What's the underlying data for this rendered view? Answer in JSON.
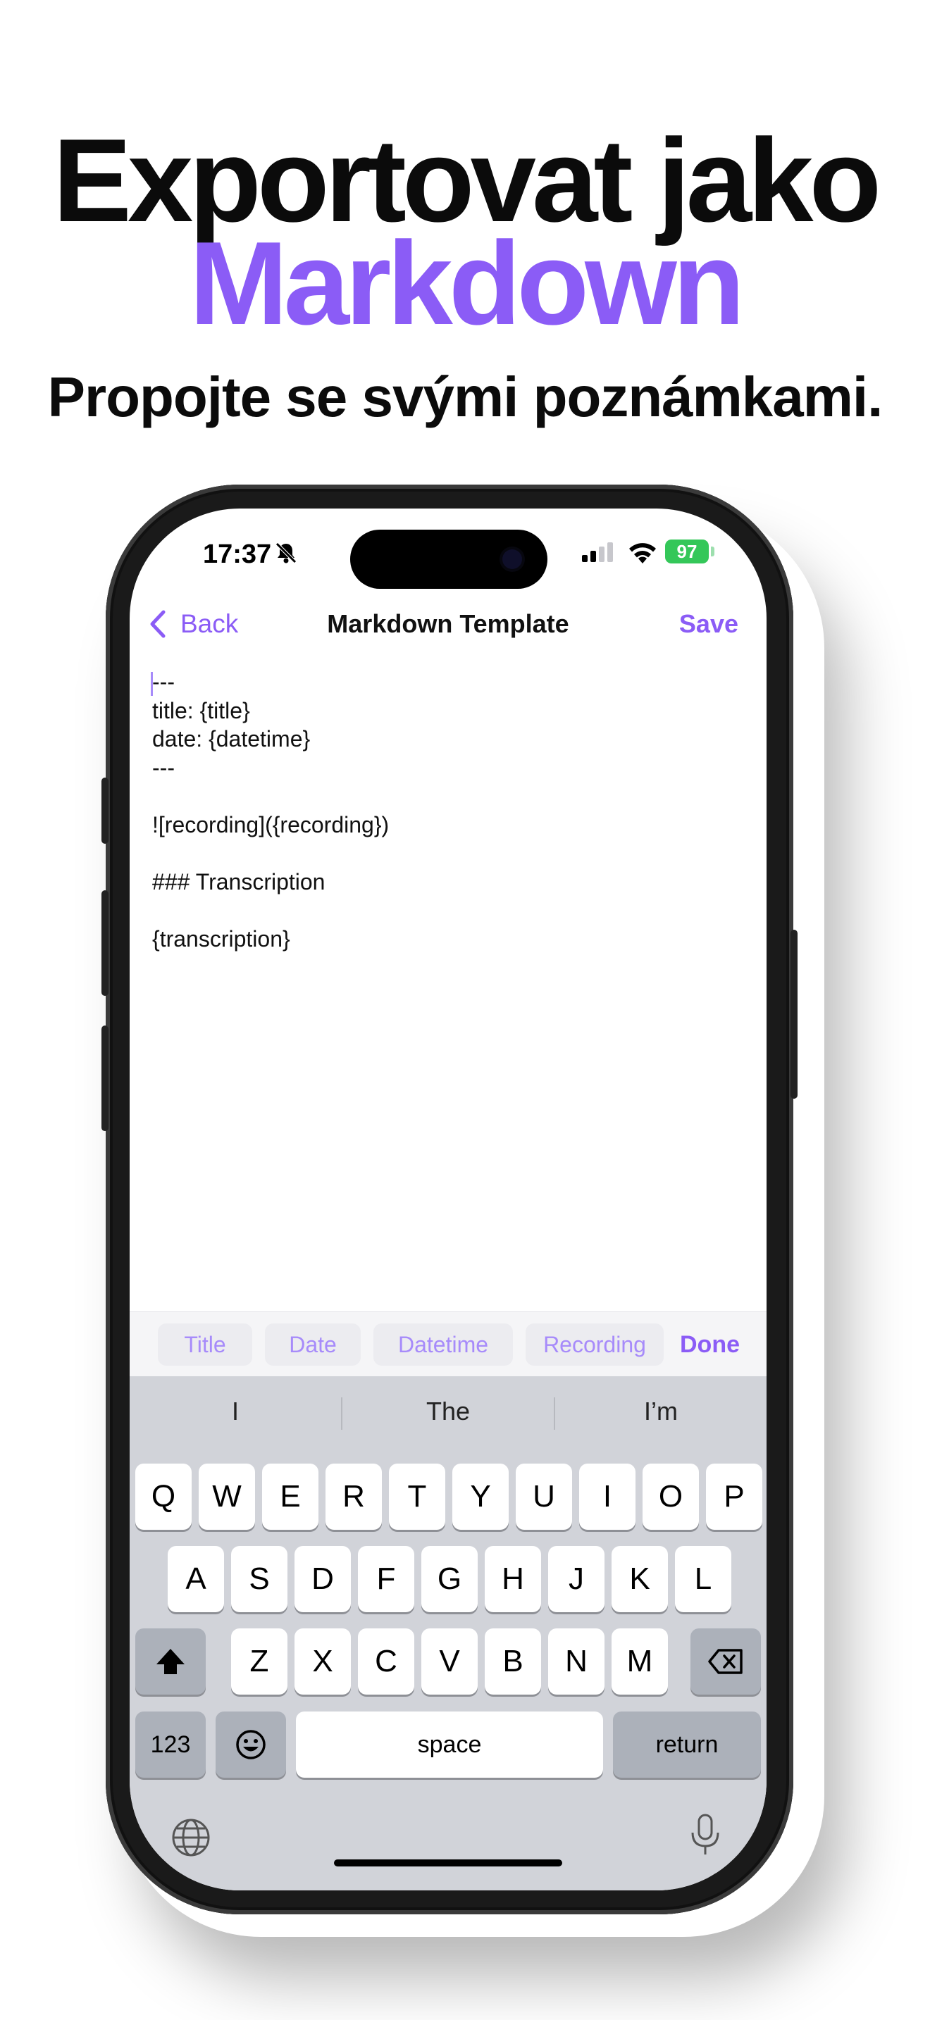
{
  "headline": {
    "line1": "Exportovat jako",
    "line2": "Markdown",
    "subtitle": "Propojte se svými poznámkami.",
    "accent_color": "#8b5cf6"
  },
  "status_bar": {
    "time": "17:37",
    "battery": "97",
    "icons": [
      "bell-slash-icon",
      "signal-icon",
      "wifi-icon",
      "battery-charging-icon"
    ]
  },
  "nav": {
    "back_label": "Back",
    "title": "Markdown Template",
    "save_label": "Save"
  },
  "editor": {
    "lines": [
      "---",
      "title: {title}",
      "date: {datetime}",
      "---",
      "",
      "![recording]({recording})",
      "",
      "### Transcription",
      "",
      "{transcription}"
    ]
  },
  "toolbar": {
    "chips": [
      "Title",
      "Date",
      "Datetime",
      "Recording"
    ],
    "done_label": "Done"
  },
  "keyboard": {
    "suggestions": [
      "I",
      "The",
      "I’m"
    ],
    "row1": [
      "Q",
      "W",
      "E",
      "R",
      "T",
      "Y",
      "U",
      "I",
      "O",
      "P"
    ],
    "row2": [
      "A",
      "S",
      "D",
      "F",
      "G",
      "H",
      "J",
      "K",
      "L"
    ],
    "row3": [
      "Z",
      "X",
      "C",
      "V",
      "B",
      "N",
      "M"
    ],
    "numbers_label": "123",
    "space_label": "space",
    "return_label": "return"
  }
}
